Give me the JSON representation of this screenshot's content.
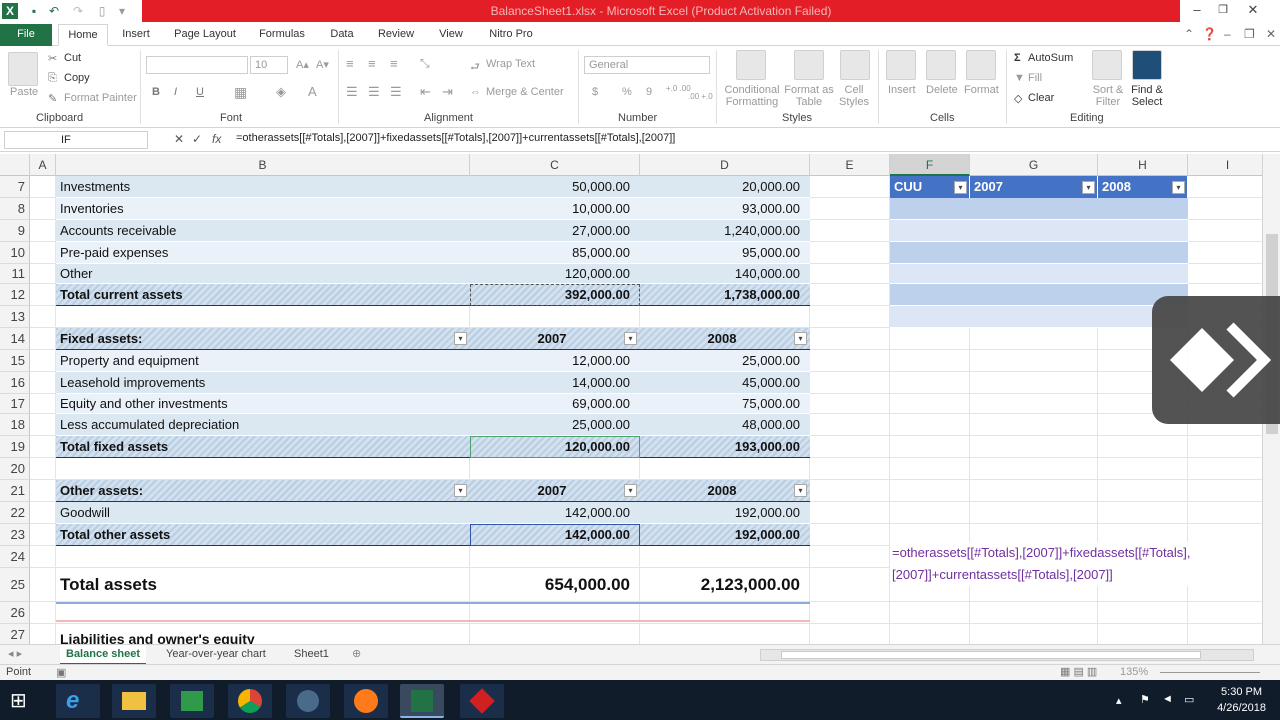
{
  "window": {
    "title": "BalanceSheet1.xlsx - Microsoft Excel (Product Activation Failed)",
    "minimize": "‒",
    "restore": "❐",
    "close": "✕"
  },
  "ribbon_tabs": [
    "File",
    "Home",
    "Insert",
    "Page Layout",
    "Formulas",
    "Data",
    "Review",
    "View",
    "Nitro Pro"
  ],
  "ribbon": {
    "clipboard": {
      "paste": "Paste",
      "cut": "Cut",
      "copy": "Copy",
      "format_painter": "Format Painter",
      "label": "Clipboard"
    },
    "font": {
      "font_name": "",
      "font_size": "10",
      "label": "Font",
      "bold": "B",
      "italic": "I",
      "underline": "U"
    },
    "alignment": {
      "wrap_text": "Wrap Text",
      "merge_center": "Merge & Center",
      "label": "Alignment"
    },
    "number": {
      "format": "General",
      "label": "Number",
      "currency": "$",
      "percent": "%",
      "comma": "9",
      "inc_decimal": "+.0 .00",
      "dec_decimal": ".00 +.0"
    },
    "styles": {
      "conditional": "Conditional Formatting",
      "format_table": "Format as Table",
      "cell_styles": "Cell Styles",
      "label": "Styles"
    },
    "cells": {
      "insert": "Insert",
      "delete": "Delete",
      "format": "Format",
      "label": "Cells"
    },
    "editing": {
      "autosum": "AutoSum",
      "fill": "Fill",
      "clear": "Clear",
      "sort_filter": "Sort & Filter",
      "find_select": "Find & Select",
      "label": "Editing"
    }
  },
  "formula_bar": {
    "name_box": "IF",
    "cancel": "✕",
    "enter": "✓",
    "fx": "fx",
    "formula": "=otherassets[[#Totals],[2007]]+fixedassets[[#Totals],[2007]]+currentassets[[#Totals],[2007]]"
  },
  "columns": [
    "A",
    "B",
    "C",
    "D",
    "E",
    "F",
    "G",
    "H",
    "I"
  ],
  "rows": [
    {
      "n": "7",
      "b": "Investments",
      "c": "50,000.00",
      "d": "20,000.00"
    },
    {
      "n": "8",
      "b": "Inventories",
      "c": "10,000.00",
      "d": "93,000.00"
    },
    {
      "n": "9",
      "b": "Accounts receivable",
      "c": "27,000.00",
      "d": "1,240,000.00"
    },
    {
      "n": "10",
      "b": "Pre-paid expenses",
      "c": "85,000.00",
      "d": "95,000.00"
    },
    {
      "n": "11",
      "b": "Other",
      "c": "120,000.00",
      "d": "140,000.00"
    },
    {
      "n": "12",
      "b": "Total current assets",
      "c": "392,000.00",
      "d": "1,738,000.00"
    },
    {
      "n": "13",
      "b": "",
      "c": "",
      "d": ""
    },
    {
      "n": "14",
      "b": "Fixed assets:",
      "c": "2007",
      "d": "2008"
    },
    {
      "n": "15",
      "b": "Property and equipment",
      "c": "12,000.00",
      "d": "25,000.00"
    },
    {
      "n": "16",
      "b": "Leasehold improvements",
      "c": "14,000.00",
      "d": "45,000.00"
    },
    {
      "n": "17",
      "b": "Equity and other investments",
      "c": "69,000.00",
      "d": "75,000.00"
    },
    {
      "n": "18",
      "b": "Less accumulated depreciation",
      "c": "25,000.00",
      "d": "48,000.00"
    },
    {
      "n": "19",
      "b": "Total fixed assets",
      "c": "120,000.00",
      "d": "193,000.00"
    },
    {
      "n": "20",
      "b": "",
      "c": "",
      "d": ""
    },
    {
      "n": "21",
      "b": "Other assets:",
      "c": "2007",
      "d": "2008"
    },
    {
      "n": "22",
      "b": "Goodwill",
      "c": "142,000.00",
      "d": "192,000.00"
    },
    {
      "n": "23",
      "b": "Total other assets",
      "c": "142,000.00",
      "d": "192,000.00"
    },
    {
      "n": "24",
      "b": "",
      "c": "",
      "d": ""
    },
    {
      "n": "25",
      "b": "Total assets",
      "c": "654,000.00",
      "d": "2,123,000.00"
    },
    {
      "n": "26",
      "b": "",
      "c": "",
      "d": ""
    },
    {
      "n": "27",
      "b": "Liabilities and owner's equity",
      "c": "",
      "d": ""
    }
  ],
  "side_table": {
    "headers": [
      "CUU",
      "2007",
      "2008"
    ]
  },
  "in_cell_formula": {
    "line1": "=otherassets[[#Totals],[2007]]+fixedassets[[#Totals],",
    "line2": "[2007]]+currentassets[[#Totals],[2007]]"
  },
  "sheet_tabs": [
    "Balance sheet",
    "Year-over-year chart",
    "Sheet1"
  ],
  "status": {
    "mode": "Point",
    "zoom": "135%"
  },
  "taskbar": {
    "time": "5:30 PM",
    "date": "4/26/2018"
  },
  "colors": {
    "excel_green": "#217346",
    "title_red": "#e41e26",
    "band_blue": "#dbe7f1",
    "header_blue": "#4472c4"
  }
}
